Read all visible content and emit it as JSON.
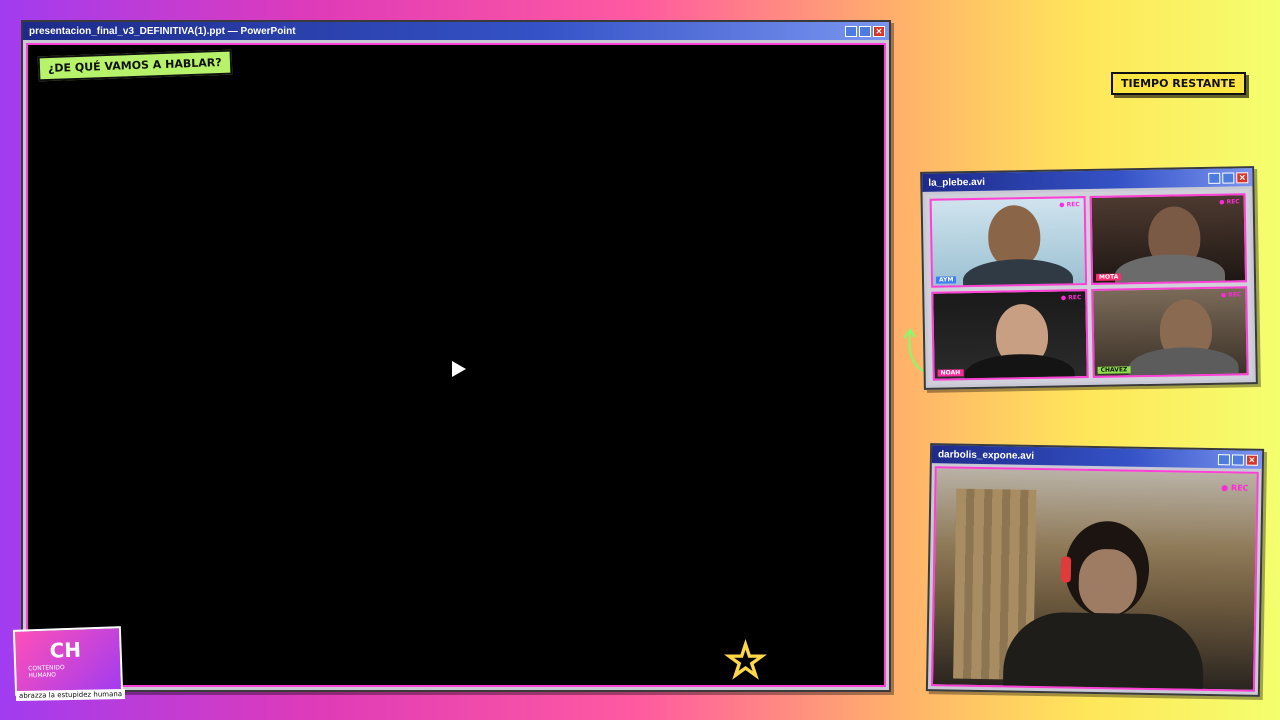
{
  "ppt_window": {
    "title": "presentacion_final_v3_DEFINITIVA(1).ppt — PowerPoint",
    "sticker": "¿DE QUÉ VAMOS A HABLAR?"
  },
  "timer_label": "TIEMPO RESTANTE",
  "plebe_window": {
    "title": "la_plebe.avi",
    "cams": [
      {
        "tag": "AYM",
        "rec": "● REC"
      },
      {
        "tag": "MOTA",
        "rec": "● REC"
      },
      {
        "tag": "NOAH",
        "rec": "● REC"
      },
      {
        "tag": "CHAVEZ",
        "rec": "● REC"
      }
    ]
  },
  "expone_window": {
    "title": "darbolis_expone.avi",
    "rec": "● REC"
  },
  "logo": {
    "big": "CH",
    "small_1": "CONTENIDO",
    "small_2": "HUMANO",
    "slogan": "abrazza la estupidez humana"
  },
  "colors": {
    "frame_accent": "#ff3fd5",
    "titlebar": "#3553c7",
    "sticker_green": "#b6f36a",
    "timer_yellow": "#ffe642"
  }
}
